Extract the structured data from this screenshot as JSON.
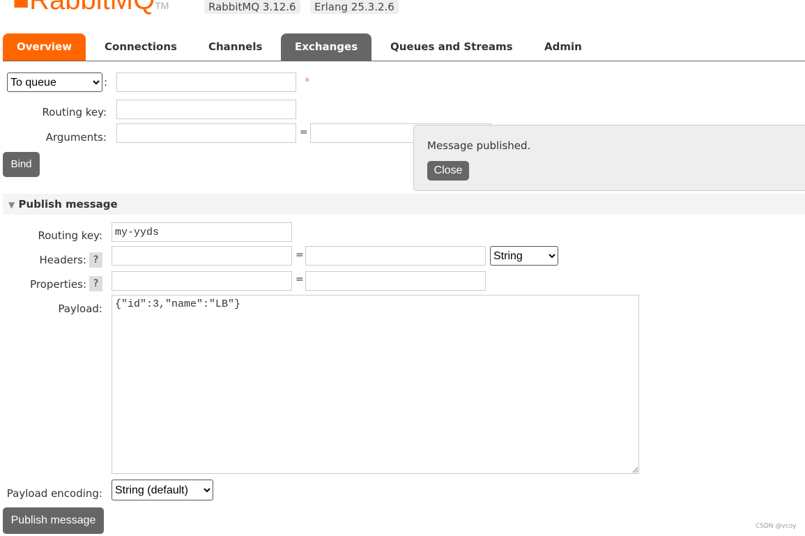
{
  "header": {
    "logo_text": "RabbitMQ",
    "logo_tm": "TM",
    "version": "RabbitMQ 3.12.6",
    "erlang": "Erlang 25.3.2.6"
  },
  "tabs": [
    {
      "label": "Overview",
      "state": "orange"
    },
    {
      "label": "Connections"
    },
    {
      "label": "Channels"
    },
    {
      "label": "Exchanges",
      "state": "active"
    },
    {
      "label": "Queues and Streams"
    },
    {
      "label": "Admin"
    }
  ],
  "bind": {
    "destination_type": "To queue",
    "required_mark": "*",
    "routing_key_label": "Routing key:",
    "arguments_label": "Arguments:",
    "equals": "=",
    "bind_label": "Bind",
    "colon": ":"
  },
  "notice": {
    "text": "Message published.",
    "close_label": "Close"
  },
  "publish": {
    "section_title": "Publish message",
    "routing_key_label": "Routing key:",
    "routing_key_value": "my-yyds",
    "headers_label": "Headers:",
    "headers_type": "String",
    "properties_label": "Properties:",
    "help": "?",
    "equals": "=",
    "payload_label": "Payload:",
    "payload_value": "{\"id\":3,\"name\":\"LB\"}",
    "encoding_label": "Payload encoding:",
    "encoding_value": "String (default)",
    "publish_label": "Publish message"
  },
  "watermark": "CSDN @vcoy",
  "colors": {
    "accent": "#ff6600",
    "active_tab": "#666666",
    "button": "#666666"
  }
}
